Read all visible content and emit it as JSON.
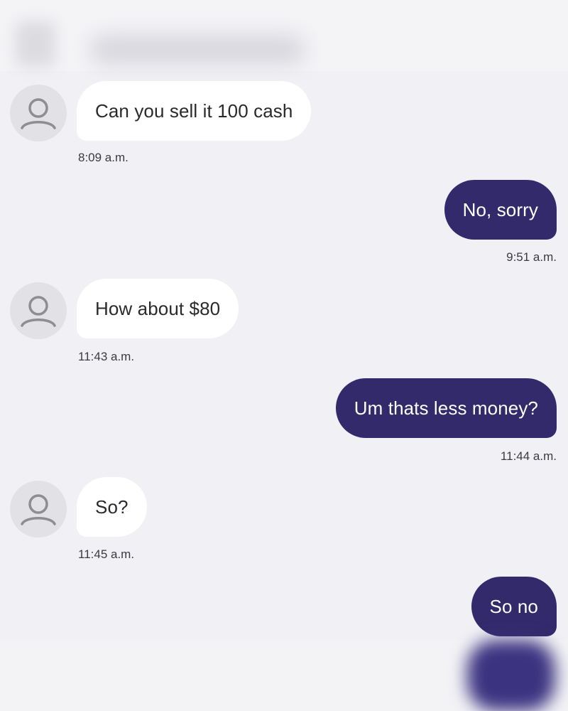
{
  "messages": [
    {
      "text": "Can you sell it 100 cash",
      "time": "8:09 a.m.",
      "dir": "in"
    },
    {
      "text": "No, sorry",
      "time": "9:51 a.m.",
      "dir": "out"
    },
    {
      "text": "How about $80",
      "time": "11:43 a.m.",
      "dir": "in"
    },
    {
      "text": "Um thats less money?",
      "time": "11:44 a.m.",
      "dir": "out"
    },
    {
      "text": "So?",
      "time": "11:45 a.m.",
      "dir": "in"
    },
    {
      "text": "So no",
      "dir": "out"
    }
  ],
  "colors": {
    "background": "#f1f1f5",
    "incoming_bubble": "#ffffff",
    "outgoing_bubble": "#332a6c",
    "outgoing_text": "#ffffff",
    "incoming_text": "#2a2a2e"
  },
  "icons": {
    "avatar": "person-placeholder-icon"
  }
}
